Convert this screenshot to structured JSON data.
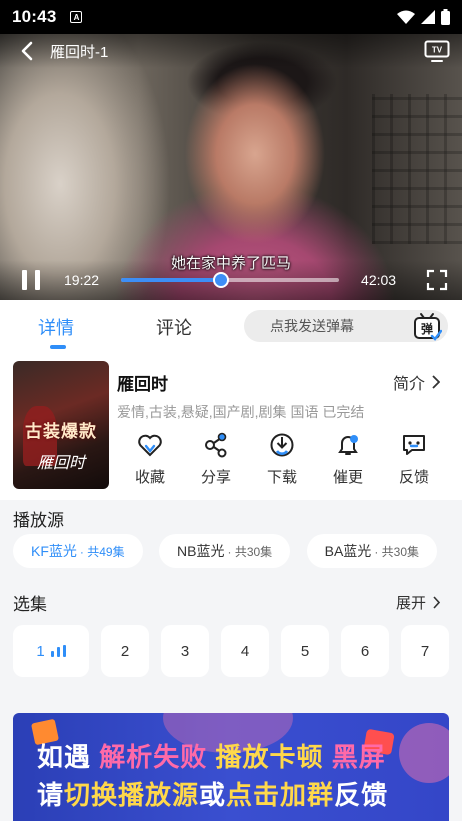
{
  "status_bar": {
    "time": "10:43",
    "notification_glyph": "A"
  },
  "player": {
    "title": "雁回时-1",
    "subtitle": "她在家中养了匹马",
    "current_time": "19:22",
    "total_time": "42:03",
    "progress_fraction": 0.46,
    "tv_icon_label": "TV"
  },
  "tabs": {
    "detail": "详情",
    "comment": "评论"
  },
  "danmu": {
    "placeholder": "点我发送弹幕",
    "icon_glyph": "弹"
  },
  "show": {
    "title": "雁回时",
    "intro_label": "简介",
    "tags": "爱情,古装,悬疑,国产剧,剧集 国语 已完结",
    "poster_text": "古装爆款",
    "poster_title": "雁回时"
  },
  "actions": [
    {
      "label": "收藏",
      "icon": "heart-icon"
    },
    {
      "label": "分享",
      "icon": "share-icon"
    },
    {
      "label": "下载",
      "icon": "download-icon"
    },
    {
      "label": "催更",
      "icon": "bell-icon"
    },
    {
      "label": "反馈",
      "icon": "feedback-icon"
    }
  ],
  "sources": {
    "title": "播放源",
    "items": [
      {
        "name": "KF蓝光",
        "count": "· 共49集",
        "active": true
      },
      {
        "name": "NB蓝光",
        "count": "· 共30集",
        "active": false
      },
      {
        "name": "BA蓝光",
        "count": "· 共30集",
        "active": false
      }
    ]
  },
  "episodes": {
    "title": "选集",
    "expand_label": "展开",
    "items": [
      "1",
      "2",
      "3",
      "4",
      "5",
      "6",
      "7"
    ]
  },
  "banner": {
    "line1": [
      "如遇 ",
      "解析失败",
      " 播放卡顿 ",
      "黑屏"
    ],
    "line2": [
      "请",
      "切换播放源",
      "或",
      "点击加群",
      "反馈"
    ]
  },
  "colors": {
    "accent": "#2f8ef8",
    "banner_bg": "#3446c8",
    "banner_pink": "#ff6aa8",
    "banner_yellow": "#ffd84a"
  }
}
